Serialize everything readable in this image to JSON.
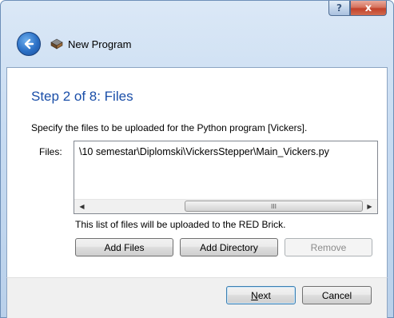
{
  "titlebar": {
    "help_label": "?",
    "close_label": "x"
  },
  "header": {
    "title": "New Program"
  },
  "wizard": {
    "step_title": "Step 2 of 8: Files",
    "description": "Specify the files to be uploaded for the Python program [Vickers].",
    "files_label": "Files:",
    "files": [
      "\\10 semestar\\Diplomski\\VickersStepper\\Main_Vickers.py"
    ],
    "scroll_thumb_grip": "III",
    "note": "This list of files will be uploaded to the RED Brick."
  },
  "buttons": {
    "add_files": "Add Files",
    "add_directory": "Add Directory",
    "remove": "Remove",
    "next_mnemonic": "N",
    "next_rest": "ext",
    "cancel": "Cancel"
  },
  "colors": {
    "step_title": "#1a4ea8",
    "back_button": "#2a6fc5"
  }
}
